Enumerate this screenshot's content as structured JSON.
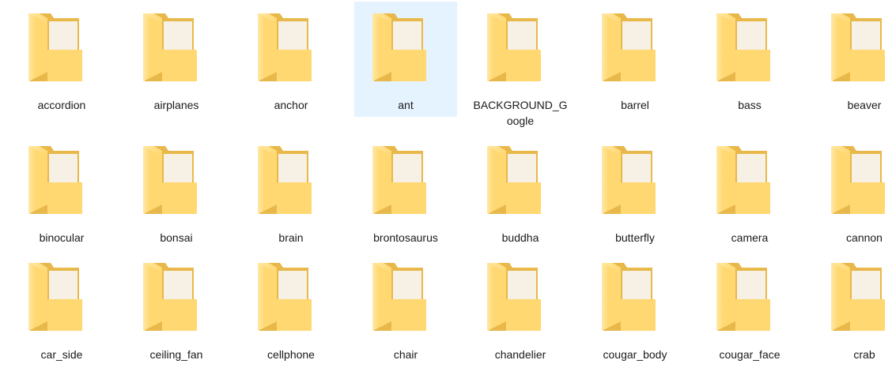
{
  "view": {
    "selected_item": "ant"
  },
  "folders": [
    {
      "name": "accordion"
    },
    {
      "name": "airplanes"
    },
    {
      "name": "anchor"
    },
    {
      "name": "ant",
      "selected": true
    },
    {
      "name": "BACKGROUND_Google"
    },
    {
      "name": "barrel"
    },
    {
      "name": "bass"
    },
    {
      "name": "beaver"
    },
    {
      "name": "binocular"
    },
    {
      "name": "bonsai"
    },
    {
      "name": "brain"
    },
    {
      "name": "brontosaurus"
    },
    {
      "name": "buddha"
    },
    {
      "name": "butterfly"
    },
    {
      "name": "camera"
    },
    {
      "name": "cannon"
    },
    {
      "name": "car_side"
    },
    {
      "name": "ceiling_fan"
    },
    {
      "name": "cellphone"
    },
    {
      "name": "chair"
    },
    {
      "name": "chandelier"
    },
    {
      "name": "cougar_body"
    },
    {
      "name": "cougar_face"
    },
    {
      "name": "crab"
    }
  ],
  "colors": {
    "folder_back": "#e8b84a",
    "folder_front": "#ffd872",
    "folder_front_light": "#ffe8a6",
    "selection": "#e5f3ff"
  },
  "icons": {
    "folder": "folder-icon"
  }
}
